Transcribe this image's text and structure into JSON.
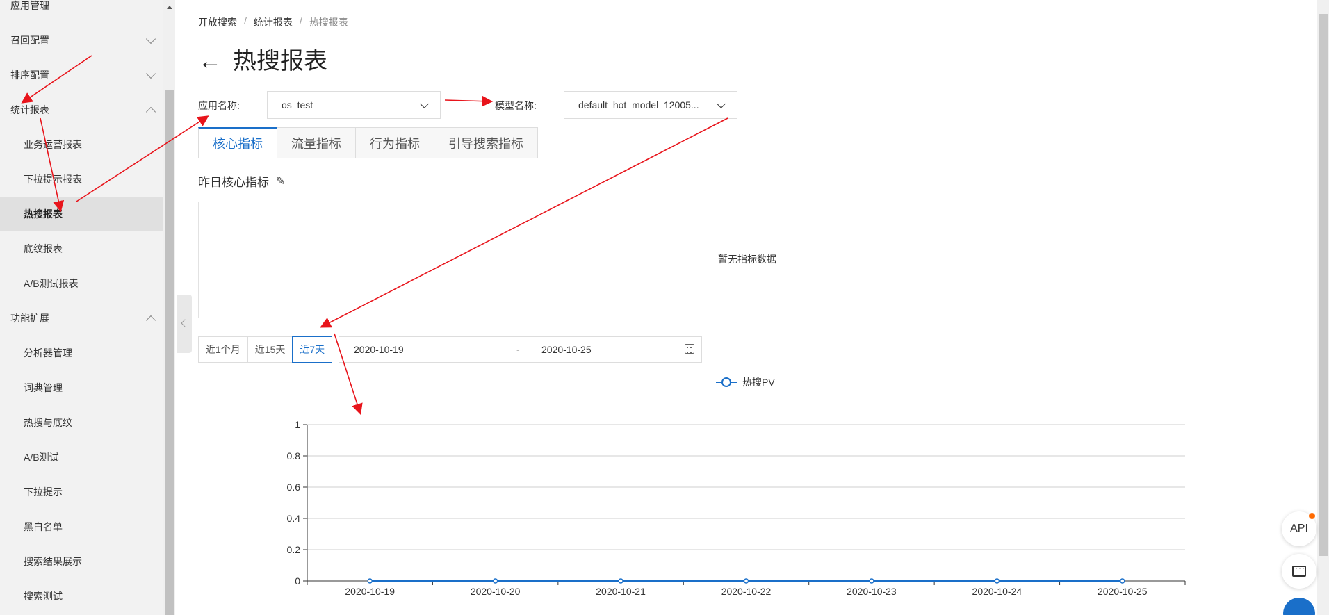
{
  "sidebar": {
    "items": [
      {
        "label": "应用管理",
        "type": "group",
        "chevron": "none"
      },
      {
        "label": "召回配置",
        "type": "group",
        "chevron": "down"
      },
      {
        "label": "排序配置",
        "type": "group",
        "chevron": "down"
      },
      {
        "label": "统计报表",
        "type": "group",
        "chevron": "up"
      },
      {
        "label": "业务运营报表",
        "type": "sub"
      },
      {
        "label": "下拉提示报表",
        "type": "sub"
      },
      {
        "label": "热搜报表",
        "type": "sub",
        "active": true
      },
      {
        "label": "底纹报表",
        "type": "sub"
      },
      {
        "label": "A/B测试报表",
        "type": "sub"
      },
      {
        "label": "功能扩展",
        "type": "group",
        "chevron": "up"
      },
      {
        "label": "分析器管理",
        "type": "sub"
      },
      {
        "label": "词典管理",
        "type": "sub"
      },
      {
        "label": "热搜与底纹",
        "type": "sub"
      },
      {
        "label": "A/B测试",
        "type": "sub"
      },
      {
        "label": "下拉提示",
        "type": "sub"
      },
      {
        "label": "黑白名单",
        "type": "sub"
      },
      {
        "label": "搜索结果展示",
        "type": "sub"
      },
      {
        "label": "搜索测试",
        "type": "sub"
      }
    ]
  },
  "breadcrumb": {
    "items": [
      "开放搜索",
      "统计报表",
      "热搜报表"
    ],
    "sep": "/"
  },
  "page": {
    "back_icon": "←",
    "title": "热搜报表"
  },
  "filters": {
    "app_label": "应用名称:",
    "app_value": "os_test",
    "model_label": "模型名称:",
    "model_value": "default_hot_model_12005..."
  },
  "tabs": [
    "核心指标",
    "流量指标",
    "行为指标",
    "引导搜索指标"
  ],
  "core": {
    "title": "昨日核心指标",
    "edit_icon": "✎",
    "empty_text": "暂无指标数据"
  },
  "range": {
    "buttons": [
      "近1个月",
      "近15天",
      "近7天"
    ],
    "active_index": 2,
    "start": "2020-10-19",
    "dash": "-",
    "end": "2020-10-25"
  },
  "floaters": {
    "api_label": "API"
  },
  "colors": {
    "accent": "#1a6fc9",
    "annotation": "#e8141b",
    "notify": "#ff6a00"
  },
  "chart_data": {
    "type": "line",
    "categories": [
      "2020-10-19",
      "2020-10-20",
      "2020-10-21",
      "2020-10-22",
      "2020-10-23",
      "2020-10-24",
      "2020-10-25"
    ],
    "series": [
      {
        "name": "热搜PV",
        "values": [
          0,
          0,
          0,
          0,
          0,
          0,
          0
        ]
      }
    ],
    "yticks": [
      "0",
      "0.2",
      "0.4",
      "0.6",
      "0.8",
      "1"
    ],
    "ylim": [
      0,
      1
    ],
    "grid": true,
    "legend": "top-center"
  }
}
